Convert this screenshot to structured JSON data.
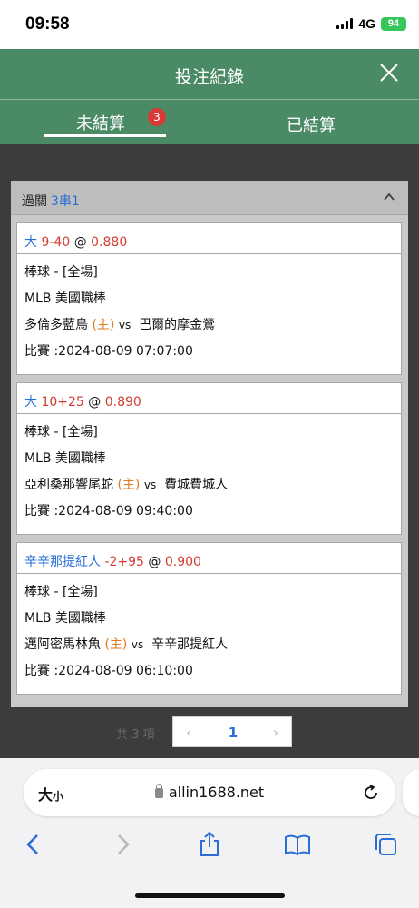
{
  "status_bar": {
    "time": "09:58",
    "network": "4G",
    "battery": "94"
  },
  "header": {
    "title": "投注紀錄"
  },
  "tabs": [
    {
      "label": "未結算",
      "badge": "3"
    },
    {
      "label": "已結算"
    }
  ],
  "panel": {
    "title": "過關",
    "combo": "3串1"
  },
  "bets": [
    {
      "selection": "大",
      "line": "9-40",
      "at": "@",
      "odds": "0.880",
      "sport": "棒球 - [全場]",
      "league": "MLB 美國職棒",
      "home_team": "多倫多藍鳥",
      "home_marker": "(主)",
      "vs": "vs",
      "away_team": "巴爾的摩金鶯",
      "match_time": "比賽 :2024-08-09 07:07:00"
    },
    {
      "selection": "大",
      "line": "10+25",
      "at": "@",
      "odds": "0.890",
      "sport": "棒球 - [全場]",
      "league": "MLB 美國職棒",
      "home_team": "亞利桑那響尾蛇",
      "home_marker": "(主)",
      "vs": "vs",
      "away_team": "費城費城人",
      "match_time": "比賽 :2024-08-09 09:40:00"
    },
    {
      "selection": "辛辛那提紅人",
      "line": "-2+95",
      "at": "@",
      "odds": "0.900",
      "sport": "棒球 - [全場]",
      "league": "MLB 美國職棒",
      "home_team": "邁阿密馬林魚",
      "home_marker": "(主)",
      "vs": "vs",
      "away_team": "辛辛那提紅人",
      "match_time": "比賽 :2024-08-09 06:10:00"
    }
  ],
  "pagination": {
    "total": "共 3 項",
    "prev": "‹",
    "current": "1",
    "next": "›"
  },
  "browser": {
    "text_size": "大",
    "text_size_small": "小",
    "url": "allin1688.net"
  },
  "colors": {
    "header": "#4a8a64",
    "badge": "#d93a35",
    "link": "#2a6fd6",
    "odds": "#d63a2f",
    "home": "#e07a1e"
  }
}
